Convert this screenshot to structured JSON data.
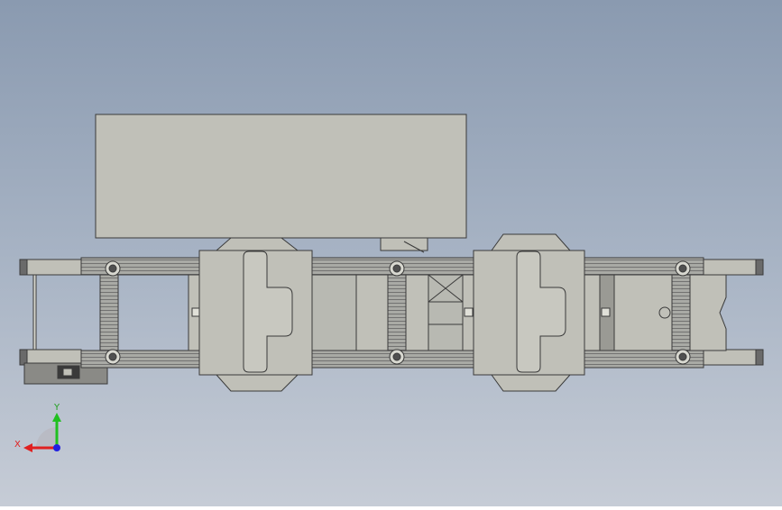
{
  "viewport": {
    "background_top": "#8a9ab0",
    "background_bottom": "#c6ccd6"
  },
  "model": {
    "part_fill": "#c0c0b8",
    "part_stroke": "#3a3a3a",
    "rail_fill": "#a9aaa5",
    "dark_fill": "#505050"
  },
  "triad": {
    "x_label": "X",
    "y_label": "Y",
    "x_color": "#e02020",
    "y_color": "#20c020",
    "z_color": "#2020e0"
  }
}
